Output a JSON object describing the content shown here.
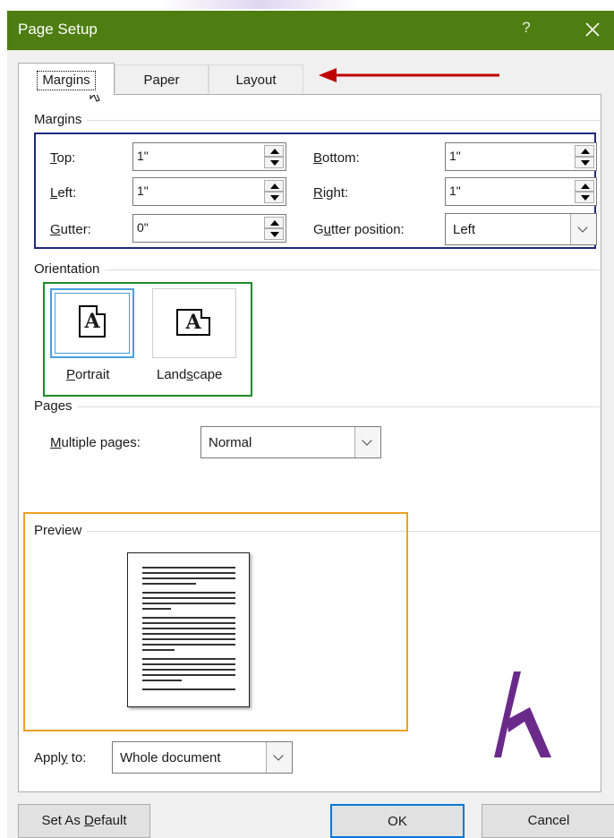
{
  "window": {
    "title": "Page Setup",
    "help": "?"
  },
  "tabs": [
    {
      "label": "Margins",
      "selected": true
    },
    {
      "label": "Paper"
    },
    {
      "label": "Layout"
    }
  ],
  "margins": {
    "section_title": "Margins",
    "top": {
      "label_key": "T",
      "label_rest": "op:",
      "value": "1\""
    },
    "left": {
      "label_key": "L",
      "label_rest": "eft:",
      "value": "1\""
    },
    "gutter": {
      "label_key": "G",
      "label_rest": "utter:",
      "value": "0\""
    },
    "bottom": {
      "label_key": "B",
      "label_rest": "ottom:",
      "value": "1\""
    },
    "right": {
      "label_key": "R",
      "label_rest": "ight:",
      "value": "1\""
    },
    "gutter_position": {
      "label_pre": "G",
      "label_key": "u",
      "label_rest": "tter position:",
      "value": "Left"
    }
  },
  "orientation": {
    "section_title": "Orientation",
    "icon_letter": "A",
    "portrait": {
      "label_key": "P",
      "label_rest": "ortrait",
      "selected": true
    },
    "landscape": {
      "label_pre": "Land",
      "label_key": "s",
      "label_rest": "cape"
    }
  },
  "pages": {
    "section_title": "Pages",
    "multiple": {
      "label_key": "M",
      "label_rest": "ultiple pages:",
      "value": "Normal"
    }
  },
  "preview": {
    "section_title": "Preview"
  },
  "apply_to": {
    "label_pre": "Appl",
    "label_key": "y",
    "label_rest": " to:",
    "value": "Whole document"
  },
  "buttons": {
    "set_default_pre": "Set As ",
    "set_default_key": "D",
    "set_default_rest": "efault",
    "ok": "OK",
    "cancel": "Cancel"
  },
  "annotation_colors": {
    "margins_box": "#1f2a7a",
    "orientation_box": "#1e8a2a",
    "preview_box": "#f0a020",
    "arrow": "#c00000",
    "logo": "#6a2a8a",
    "titlebar": "#4e7d12"
  }
}
